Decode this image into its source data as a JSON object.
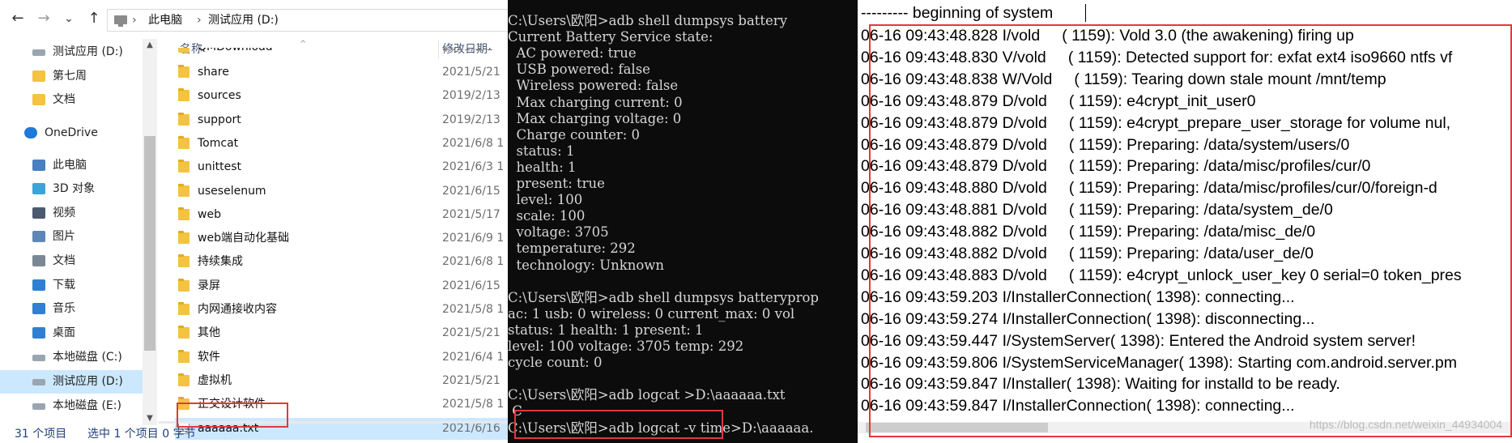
{
  "explorer": {
    "address": {
      "crumbs": [
        "此电脑",
        "测试应用 (D:)"
      ],
      "separator": "›"
    },
    "nav_buttons": {
      "back": "←",
      "forward": "→",
      "dropdown": "⌄",
      "up": "↑"
    },
    "sidebar": {
      "items": [
        {
          "label": "测试应用 (D:)",
          "icon": "drive-icon"
        },
        {
          "label": "第七周",
          "icon": "folder-icon"
        },
        {
          "label": "文档",
          "icon": "folder-icon"
        },
        {
          "label": "OneDrive",
          "icon": "onedrive-icon"
        },
        {
          "label": "此电脑",
          "icon": "computer-icon"
        },
        {
          "label": "3D 对象",
          "icon": "3d-objects-icon"
        },
        {
          "label": "视频",
          "icon": "video-icon"
        },
        {
          "label": "图片",
          "icon": "pictures-icon"
        },
        {
          "label": "文档",
          "icon": "documents-icon"
        },
        {
          "label": "下载",
          "icon": "download-icon"
        },
        {
          "label": "音乐",
          "icon": "music-icon"
        },
        {
          "label": "桌面",
          "icon": "desktop-icon"
        },
        {
          "label": "本地磁盘 (C:)",
          "icon": "drive-icon"
        },
        {
          "label": "测试应用 (D:)",
          "icon": "drive-icon"
        },
        {
          "label": "本地磁盘 (E:)",
          "icon": "drive-icon"
        }
      ]
    },
    "columns": {
      "name": "名称",
      "modified": "修改日期"
    },
    "files": [
      {
        "name": "QMDownload",
        "date": "2021/5/1",
        "type": "folder"
      },
      {
        "name": "share",
        "date": "2021/5/21",
        "type": "folder"
      },
      {
        "name": "sources",
        "date": "2019/2/13",
        "type": "folder"
      },
      {
        "name": "support",
        "date": "2019/2/13",
        "type": "folder"
      },
      {
        "name": "Tomcat",
        "date": "2021/6/8 1",
        "type": "folder"
      },
      {
        "name": "unittest",
        "date": "2021/6/3 1",
        "type": "folder"
      },
      {
        "name": "useselenum",
        "date": "2021/6/15",
        "type": "folder"
      },
      {
        "name": "web",
        "date": "2021/5/17",
        "type": "folder"
      },
      {
        "name": "web端自动化基础",
        "date": "2021/6/9 1",
        "type": "folder"
      },
      {
        "name": "持续集成",
        "date": "2021/6/8 1",
        "type": "folder"
      },
      {
        "name": "录屏",
        "date": "2021/6/15",
        "type": "folder"
      },
      {
        "name": "内网通接收内容",
        "date": "2021/5/8 1",
        "type": "folder"
      },
      {
        "name": "其他",
        "date": "2021/5/21",
        "type": "folder"
      },
      {
        "name": "软件",
        "date": "2021/6/4 1",
        "type": "folder"
      },
      {
        "name": "虚拟机",
        "date": "2021/5/21",
        "type": "folder"
      },
      {
        "name": "正交设计软件",
        "date": "2021/5/8 1",
        "type": "folder"
      },
      {
        "name": "aaaaaa.txt",
        "date": "2021/6/16",
        "type": "txt"
      }
    ],
    "status": {
      "count": "31 个项目",
      "selected": "选中 1 个项目  0 字节"
    }
  },
  "console": {
    "lines": [
      "C:\\Users\\欧阳>adb shell dumpsys battery",
      "Current Battery Service state:",
      "  AC powered: true",
      "  USB powered: false",
      "  Wireless powered: false",
      "  Max charging current: 0",
      "  Max charging voltage: 0",
      "  Charge counter: 0",
      "  status: 1",
      "  health: 1",
      "  present: true",
      "  level: 100",
      "  scale: 100",
      "  voltage: 3705",
      "  temperature: 292",
      "  technology: Unknown",
      "",
      "C:\\Users\\欧阳>adb shell dumpsys batteryprop",
      "ac: 1 usb: 0 wireless: 0 current_max: 0 vol",
      "status: 1 health: 1 present: 1",
      "level: 100 voltage: 3705 temp: 292",
      "cycle count: 0",
      "",
      "C:\\Users\\欧阳>adb logcat >D:\\aaaaaa.txt",
      " C",
      "C:\\Users\\欧阳>adb logcat -v time>D:\\aaaaaa."
    ]
  },
  "log": {
    "header": "--------- beginning of system",
    "lines": [
      "06-16 09:43:48.828 I/vold     ( 1159): Vold 3.0 (the awakening) firing up",
      "06-16 09:43:48.830 V/vold     ( 1159): Detected support for: exfat ext4 iso9660 ntfs vf",
      "06-16 09:43:48.838 W/Vold     ( 1159): Tearing down stale mount /mnt/temp",
      "06-16 09:43:48.879 D/vold     ( 1159): e4crypt_init_user0",
      "06-16 09:43:48.879 D/vold     ( 1159): e4crypt_prepare_user_storage for volume nul,",
      "06-16 09:43:48.879 D/vold     ( 1159): Preparing: /data/system/users/0",
      "06-16 09:43:48.879 D/vold     ( 1159): Preparing: /data/misc/profiles/cur/0",
      "06-16 09:43:48.880 D/vold     ( 1159): Preparing: /data/misc/profiles/cur/0/foreign-d",
      "06-16 09:43:48.881 D/vold     ( 1159): Preparing: /data/system_de/0",
      "06-16 09:43:48.882 D/vold     ( 1159): Preparing: /data/misc_de/0",
      "06-16 09:43:48.882 D/vold     ( 1159): Preparing: /data/user_de/0",
      "06-16 09:43:48.883 D/vold     ( 1159): e4crypt_unlock_user_key 0 serial=0 token_pres",
      "06-16 09:43:59.203 I/InstallerConnection( 1398): connecting...",
      "06-16 09:43:59.274 I/InstallerConnection( 1398): disconnecting...",
      "06-16 09:43:59.447 I/SystemServer( 1398): Entered the Android system server!",
      "06-16 09:43:59.806 I/SystemServiceManager( 1398): Starting com.android.server.pm",
      "06-16 09:43:59.847 I/Installer( 1398): Waiting for installd to be ready.",
      "06-16 09:43:59.847 I/InstallerConnection( 1398): connecting..."
    ],
    "watermark": "https://blog.csdn.net/weixin_44934004"
  },
  "colors": {
    "highlight": "#e0393e",
    "selection": "#cce8ff",
    "console_bg": "#0c0c0c"
  }
}
